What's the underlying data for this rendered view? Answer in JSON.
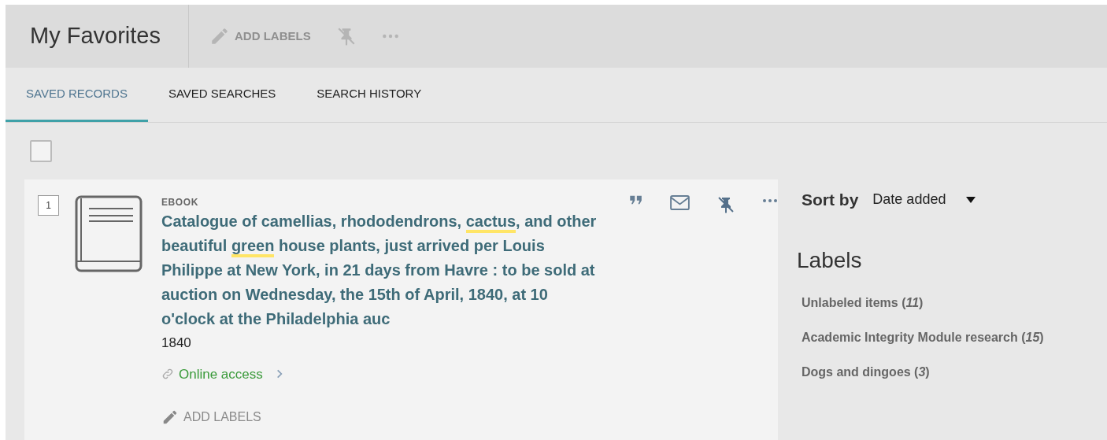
{
  "header": {
    "title": "My Favorites",
    "add_labels": "ADD LABELS"
  },
  "tabs": [
    {
      "label": "SAVED RECORDS",
      "selected": true
    },
    {
      "label": "SAVED SEARCHES",
      "selected": false
    },
    {
      "label": "SEARCH HISTORY",
      "selected": false
    }
  ],
  "select_all": {
    "checked": false
  },
  "records": [
    {
      "number": "1",
      "type": "EBOOK",
      "title": [
        {
          "text": "Catalogue of camellias, rhododendrons, ",
          "highlighted": false
        },
        {
          "text": "cactus",
          "highlighted": true
        },
        {
          "text": ", and other beautiful ",
          "highlighted": false
        },
        {
          "text": "green",
          "highlighted": true
        },
        {
          "text": " house plants, just arrived per Louis Philippe at New York, in 21 days from Havre : to be sold at auction on Wednesday, the 15th of April, 1840, at 10 o'clock at the Philadelphia auc",
          "highlighted": false
        }
      ],
      "year": "1840",
      "access": "Online access",
      "add_labels": "ADD LABELS"
    }
  ],
  "sort": {
    "label": "Sort by",
    "value": "Date added"
  },
  "labels": {
    "heading": "Labels",
    "items": [
      "Unlabeled items (*11*)",
      "Academic Integrity Module research (*15*)",
      "Dogs and dingoes (*3*)"
    ]
  }
}
